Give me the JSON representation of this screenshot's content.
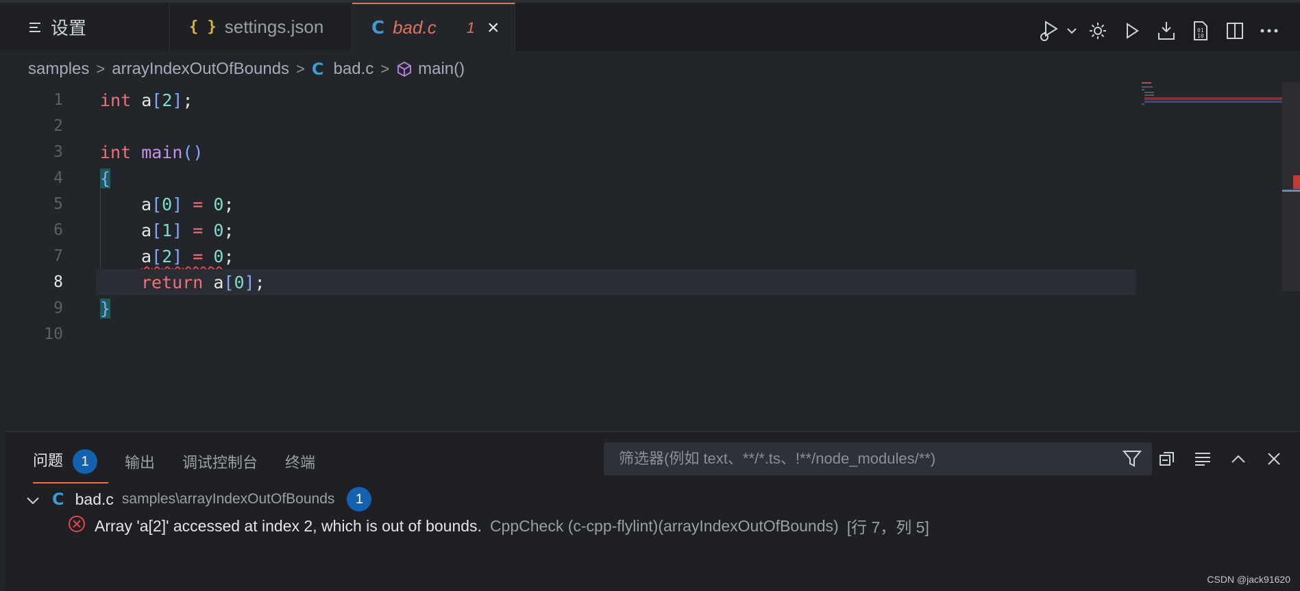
{
  "tabs": [
    {
      "label": "设置",
      "icon": "list-icon"
    },
    {
      "label": "settings.json",
      "icon": "json-braces-icon",
      "icon_glyph": "{ }"
    },
    {
      "label": "bad.c",
      "icon": "c-file-icon",
      "icon_glyph": "C",
      "problems": "1",
      "close_glyph": "×"
    }
  ],
  "toolbar": [
    "run-debug-icon",
    "chevron-down-icon",
    "gear-icon",
    "run-icon",
    "download-icon",
    "binary-file-icon",
    "split-editor-icon",
    "more-icon"
  ],
  "breadcrumb": {
    "items": [
      "samples",
      "arrayIndexOutOfBounds",
      "bad.c",
      "main()"
    ],
    "separator": ">",
    "c_glyph": "C"
  },
  "editor": {
    "line_numbers": [
      "1",
      "2",
      "3",
      "4",
      "5",
      "6",
      "7",
      "8",
      "9",
      "10"
    ],
    "current_line": "8",
    "code_line_1": {
      "kw": "int",
      "name": " a",
      "br_open": "[",
      "num": "2",
      "br_close": "]",
      "end": ";"
    },
    "code_line_3": {
      "kw": "int",
      "fn": " main",
      "parens": "()"
    },
    "code_line_4": {
      "brace": "{"
    },
    "code_line_5": {
      "name": "a",
      "br_open": "[",
      "num": "0",
      "br_close": "]",
      "op": " = ",
      "val": "0",
      "end": ";"
    },
    "code_line_6": {
      "name": "a",
      "br_open": "[",
      "num": "1",
      "br_close": "]",
      "op": " = ",
      "val": "0",
      "end": ";"
    },
    "code_line_7": {
      "name": "a",
      "br_open": "[",
      "num": "2",
      "br_close": "]",
      "op": " = ",
      "val": "0",
      "end": ";"
    },
    "code_line_8": {
      "kw": "return",
      "name": " a",
      "br_open": "[",
      "num": "0",
      "br_close": "]",
      "end": ";"
    },
    "code_line_9": {
      "brace": "}"
    }
  },
  "panel": {
    "tabs": [
      "问题",
      "输出",
      "调试控制台",
      "终端"
    ],
    "problems_count": "1",
    "filter_placeholder": "筛选器(例如 text、**/*.ts、!**/node_modules/**)",
    "file": {
      "name": "bad.c",
      "path": "samples\\arrayIndexOutOfBounds",
      "count": "1",
      "c_glyph": "C"
    },
    "problem": {
      "message": "Array 'a[2]' accessed at index 2, which is out of bounds.",
      "source": "CppCheck (c-cpp-flylint)(arrayIndexOutOfBounds)",
      "location": "[行 7，列 5]"
    },
    "actions": [
      "filter-icon",
      "collapse-all-icon",
      "word-wrap-icon",
      "maximize-panel-icon",
      "close-panel-icon"
    ]
  },
  "watermark": "CSDN @jack91620",
  "colors": {
    "accent": "#e0735a",
    "badge": "#1461b0",
    "error": "#e8464f"
  }
}
